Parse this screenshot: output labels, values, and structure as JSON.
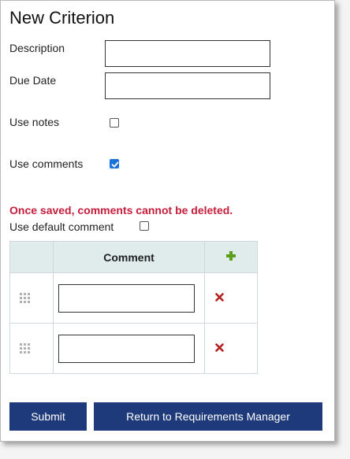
{
  "form": {
    "title": "New Criterion",
    "description_label": "Description",
    "description_value": "",
    "due_date_label": "Due Date",
    "due_date_value": "",
    "use_notes_label": "Use notes",
    "use_notes_checked": false,
    "use_comments_label": "Use comments",
    "use_comments_checked": true,
    "warning": "Once saved, comments cannot be deleted.",
    "use_default_comment_label": "Use default comment",
    "use_default_comment_checked": false
  },
  "comments_table": {
    "header": "Comment",
    "rows": [
      {
        "value": ""
      },
      {
        "value": ""
      }
    ]
  },
  "buttons": {
    "submit": "Submit",
    "return": "Return to Requirements Manager"
  },
  "colors": {
    "warning": "#c41e3a",
    "button_bg": "#1e3a7a",
    "table_header_bg": "#dfeceb",
    "add_icon": "#5a9e1a",
    "delete_icon": "#b22222",
    "checkbox_checked": "#1a73d9"
  },
  "icons": {
    "add": "plus-icon",
    "delete": "close-icon",
    "drag": "drag-handle-icon"
  }
}
